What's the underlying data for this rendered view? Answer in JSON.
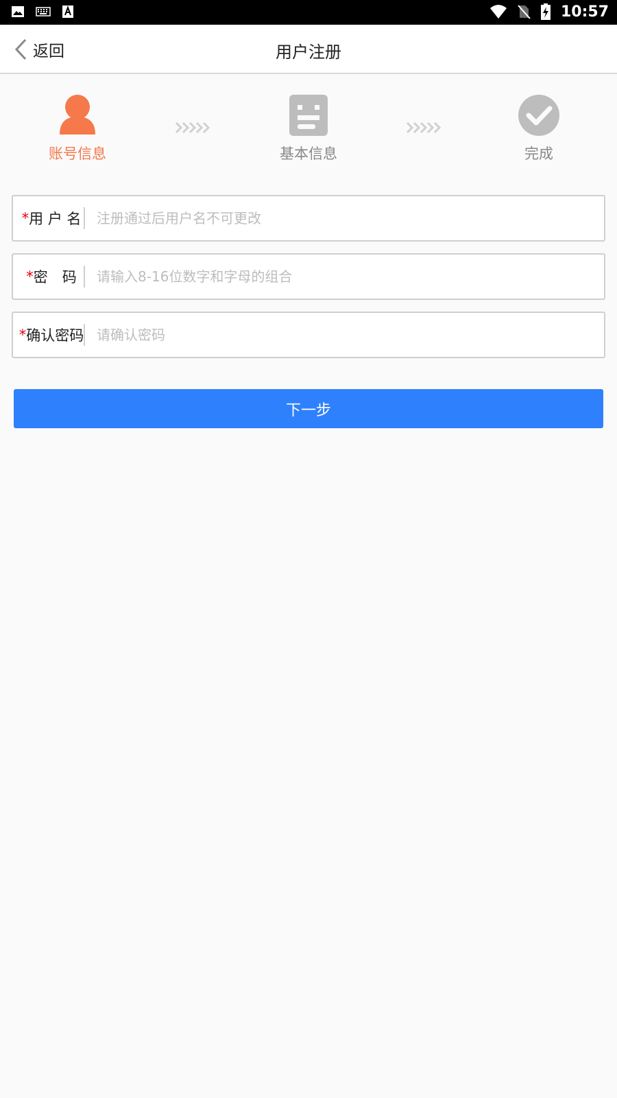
{
  "status_bar": {
    "time": "10:57",
    "left_icons": [
      "image-icon",
      "keyboard-icon",
      "text-a-icon"
    ],
    "right_icons": [
      "wifi-icon",
      "no-sim-icon",
      "battery-charging-icon"
    ]
  },
  "nav": {
    "back_label": "返回",
    "title": "用户注册"
  },
  "steps": [
    {
      "label": "账号信息",
      "icon": "user-icon",
      "state": "active"
    },
    {
      "label": "基本信息",
      "icon": "info-card-icon",
      "state": "inactive"
    },
    {
      "label": "完成",
      "icon": "check-circle-icon",
      "state": "inactive"
    }
  ],
  "form": {
    "username": {
      "required_mark": "*",
      "label": "用 户 名",
      "placeholder": "注册通过后用户名不可更改",
      "value": ""
    },
    "password": {
      "required_mark": "*",
      "label": "密　码",
      "placeholder": "请输入8-16位数字和字母的组合",
      "value": ""
    },
    "confirm_password": {
      "required_mark": "*",
      "label": "确认密码",
      "placeholder": "请确认密码",
      "value": ""
    }
  },
  "next_button_label": "下一步",
  "colors": {
    "accent_active": "#f5794a",
    "inactive_icon": "#bdbdbd",
    "primary_button": "#2f80fc",
    "required_mark": "#e60012"
  }
}
